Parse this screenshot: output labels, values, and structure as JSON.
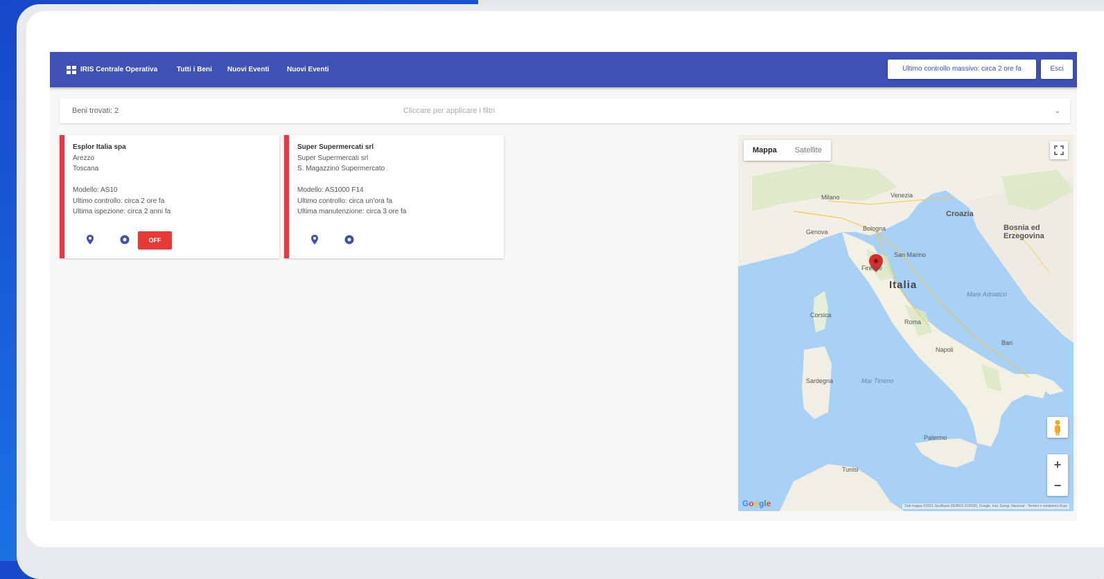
{
  "navbar": {
    "brand": "IRIS Centrale Operativa",
    "links": [
      "Tutti i Beni",
      "Nuovi Eventi",
      "Nuovi Eventi"
    ],
    "last_check_button": "Ultimo controllo massivo: circa 2 ore fa",
    "exit_button": "Esci"
  },
  "filter": {
    "count_label": "Beni trovati: 2",
    "select_placeholder": "Cliccare per applicare i filtri"
  },
  "cards": [
    {
      "title": "Esplor Italia spa",
      "line1": "Arezzo",
      "line2": "Toscana",
      "model": "Modello: AS10",
      "last_check": "Ultimo controllo: circa 2 ore fa",
      "last_inspection": "Ultima ispezione: circa 2 anni fa",
      "button": "OFF"
    },
    {
      "title": "Super Supermercati srl",
      "line1": "Super Supermercati srl",
      "line2": "S. Magazzino Supermercato",
      "model": "Modello: AS1000 F14",
      "last_check": "Ultimo controllo: circa un'ora fa",
      "last_inspection": "Ultima manutenzione: circa 3 ore fa"
    }
  ],
  "map": {
    "tab_map": "Mappa",
    "tab_satellite": "Satellite",
    "zoom_in": "+",
    "zoom_out": "−",
    "country_label": "Italia",
    "labels": {
      "milano": "Milano",
      "venezia": "Venezia",
      "genova": "Genova",
      "bologna": "Bologna",
      "firenze": "Firenze",
      "sanmarino": "San Marino",
      "roma": "Roma",
      "napoli": "Napoli",
      "bari": "Bari",
      "palermo": "Palermo",
      "croazia": "Croazia",
      "bosnia": "Bosnia ed Erzegovina",
      "corsica": "Corsica",
      "sardegna": "Sardegna",
      "tirreno": "Mar Tirreno",
      "adriatico": "Mare Adriatico",
      "tunisi": "Tunisi"
    },
    "google": "Google",
    "attribution": "Dati mappa ©2021 GeoBasis-DE/BKG (©2009), Google, Inst. Geogr. Nacional · Termini e condizioni d'uso",
    "marker_color": "#d32f2f"
  },
  "colors": {
    "primary": "#3f51b5",
    "danger": "#e53935"
  }
}
